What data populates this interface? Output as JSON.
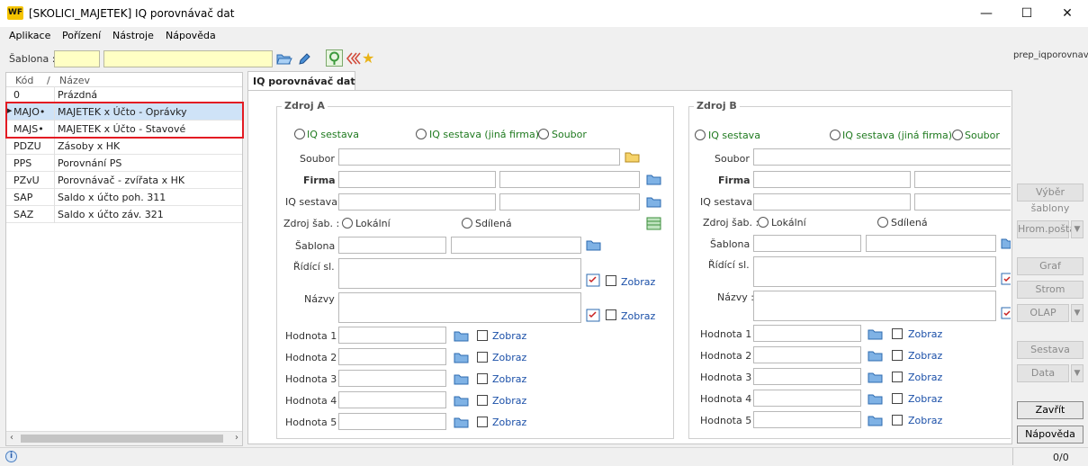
{
  "window": {
    "title": "[SKOLICI_MAJETEK] IQ porovnávač dat",
    "logo": "WF",
    "min": "—",
    "max": "☐",
    "close": "✕"
  },
  "menu": [
    "Aplikace",
    "Pořízení",
    "Nástroje",
    "Nápověda"
  ],
  "toolbar": {
    "sablona_label": "Šablona :",
    "sablona_code": "",
    "sablona_name": "",
    "hint": "prep_iqporovnav"
  },
  "list": {
    "col_code": "Kód",
    "col_sort": "/",
    "col_name": "Název",
    "rows": [
      {
        "code": "0",
        "name": "Prázdná"
      },
      {
        "code": "MAJO•",
        "name": "MAJETEK x Účto - Oprávky",
        "selected": true
      },
      {
        "code": "MAJS•",
        "name": "MAJETEK x Účto - Stavové"
      },
      {
        "code": "PDZU",
        "name": "Zásoby x HK"
      },
      {
        "code": "PPS",
        "name": "Porovnání PS"
      },
      {
        "code": "PZvU",
        "name": "Porovnávač - zvířata x HK"
      },
      {
        "code": "SAP",
        "name": "Saldo x účto poh. 311"
      },
      {
        "code": "SAZ",
        "name": "Saldo x účto záv. 321"
      }
    ]
  },
  "tab": {
    "label": "IQ porovnávač dat"
  },
  "zdrojA": {
    "title": "Zdroj A",
    "r_iq": "IQ sestava",
    "r_iq_other": "IQ sestava (jiná firma)",
    "r_file": "Soubor",
    "soubor": "Soubor :",
    "firma": "Firma :",
    "iq_sestava": "IQ sestava",
    "zdroj_sab": "Zdroj šab. :",
    "lokalni": "Lokální",
    "sdilena": "Sdílená",
    "sablona": "Šablona :",
    "ridici": "Řídící sl. :",
    "nazvy": "Názvy :",
    "zobraz": "Zobraz",
    "hodnoty": [
      "Hodnota 1 :",
      "Hodnota 2 :",
      "Hodnota 3 :",
      "Hodnota 4 :",
      "Hodnota 5 :"
    ]
  },
  "zdrojB": {
    "title": "Zdroj B",
    "r_iq": "IQ sestava",
    "r_iq_other": "IQ sestava (jiná firma)",
    "r_file": "Soubor",
    "soubor": "Soubor :",
    "firma": "Firma :",
    "iq_sestava": "IQ sestava",
    "zdroj_sab": "Zdroj šab. :",
    "lokalni": "Lokální",
    "sdilena": "Sdílená",
    "sablona": "Šablona :",
    "ridici": "Řídící sl. :",
    "nazvy": "Názvy :",
    "zobraz": "Zobraz",
    "hodnoty": [
      "Hodnota 1 :",
      "Hodnota 2 :",
      "Hodnota 3 :",
      "Hodnota 4 :",
      "Hodnota 5 :"
    ]
  },
  "right": {
    "vyber": "Výběr šablony",
    "hrom": "Hrom.pošta",
    "graf": "Graf",
    "strom": "Strom",
    "olap": "OLAP",
    "sestava": "Sestava",
    "data": "Data",
    "zavrit": "Zavřít",
    "napoveda": "Nápověda"
  },
  "status": {
    "info": "i",
    "count": "0/0"
  }
}
